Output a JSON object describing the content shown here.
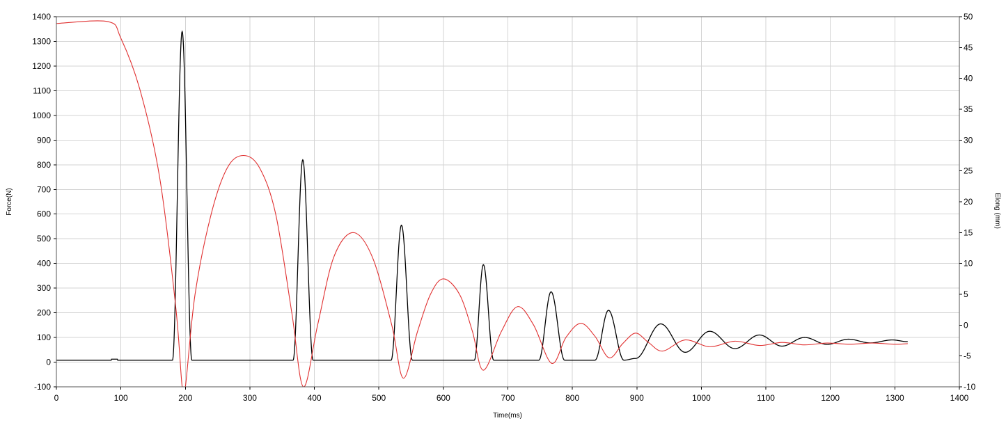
{
  "chart_data": {
    "type": "line",
    "xlabel": "Time(ms)",
    "ylabel": "Force(N)",
    "y2label": "Elong (mm)",
    "xlim": [
      0,
      1400
    ],
    "ylim": [
      -100,
      1400
    ],
    "y2lim": [
      -10,
      50
    ],
    "grid": true,
    "xticks": [
      "0",
      "100",
      "200",
      "300",
      "400",
      "500",
      "600",
      "700",
      "800",
      "900",
      "1000",
      "1100",
      "1200",
      "1300",
      "1400"
    ],
    "yticks": [
      "-100",
      "0",
      "100",
      "200",
      "300",
      "400",
      "500",
      "600",
      "700",
      "800",
      "900",
      "1000",
      "1100",
      "1200",
      "1300",
      "1400"
    ],
    "y2ticks": [
      "-10",
      "-5",
      "0",
      "5",
      "10",
      "15",
      "20",
      "25",
      "30",
      "35",
      "40",
      "45",
      "50"
    ],
    "series": [
      {
        "axis": "left",
        "color": "#000000",
        "baseline": 8,
        "start_x": 0,
        "end_x": 1320,
        "pulses": [
          {
            "start": 180,
            "peak_x": 195,
            "end": 210,
            "peak": 1340
          },
          {
            "start": 367,
            "peak_x": 382,
            "end": 398,
            "peak": 820
          },
          {
            "start": 519,
            "peak_x": 535,
            "end": 552,
            "peak": 555
          },
          {
            "start": 648,
            "peak_x": 662,
            "end": 678,
            "peak": 395
          },
          {
            "start": 748,
            "peak_x": 767,
            "end": 788,
            "peak": 285
          },
          {
            "start": 835,
            "peak_x": 856,
            "end": 880,
            "peak": 210
          }
        ],
        "tail_oscillation": [
          {
            "x": 898,
            "y": 15
          },
          {
            "x": 937,
            "y": 155
          },
          {
            "x": 975,
            "y": 40
          },
          {
            "x": 1013,
            "y": 125
          },
          {
            "x": 1052,
            "y": 55
          },
          {
            "x": 1090,
            "y": 110
          },
          {
            "x": 1125,
            "y": 65
          },
          {
            "x": 1160,
            "y": 100
          },
          {
            "x": 1195,
            "y": 72
          },
          {
            "x": 1228,
            "y": 93
          },
          {
            "x": 1262,
            "y": 78
          },
          {
            "x": 1296,
            "y": 90
          },
          {
            "x": 1320,
            "y": 83
          }
        ]
      },
      {
        "axis": "right",
        "color": "#e03030",
        "points": [
          {
            "x": 0,
            "y": 48.9
          },
          {
            "x": 80,
            "y": 49.2
          },
          {
            "x": 100,
            "y": 46.5
          },
          {
            "x": 130,
            "y": 38
          },
          {
            "x": 160,
            "y": 24
          },
          {
            "x": 185,
            "y": 3
          },
          {
            "x": 195,
            "y": -10
          },
          {
            "x": 200,
            "y": -10
          },
          {
            "x": 215,
            "y": 5
          },
          {
            "x": 240,
            "y": 18
          },
          {
            "x": 265,
            "y": 25.5
          },
          {
            "x": 290,
            "y": 27.5
          },
          {
            "x": 315,
            "y": 25.5
          },
          {
            "x": 340,
            "y": 18
          },
          {
            "x": 365,
            "y": 2
          },
          {
            "x": 383,
            "y": -10
          },
          {
            "x": 405,
            "y": 0
          },
          {
            "x": 430,
            "y": 11
          },
          {
            "x": 460,
            "y": 15
          },
          {
            "x": 490,
            "y": 11
          },
          {
            "x": 520,
            "y": 0
          },
          {
            "x": 538,
            "y": -8.6
          },
          {
            "x": 560,
            "y": -1
          },
          {
            "x": 580,
            "y": 5
          },
          {
            "x": 600,
            "y": 7.5
          },
          {
            "x": 625,
            "y": 5
          },
          {
            "x": 645,
            "y": -1
          },
          {
            "x": 662,
            "y": -7.3
          },
          {
            "x": 690,
            "y": -1
          },
          {
            "x": 715,
            "y": 3
          },
          {
            "x": 740,
            "y": 0
          },
          {
            "x": 768,
            "y": -6.2
          },
          {
            "x": 790,
            "y": -2
          },
          {
            "x": 813,
            "y": 0.3
          },
          {
            "x": 835,
            "y": -1.8
          },
          {
            "x": 857,
            "y": -5.3
          },
          {
            "x": 878,
            "y": -3
          },
          {
            "x": 898,
            "y": -1.3
          },
          {
            "x": 918,
            "y": -2.8
          },
          {
            "x": 940,
            "y": -4.2
          },
          {
            "x": 975,
            "y": -2.4
          },
          {
            "x": 1013,
            "y": -3.5
          },
          {
            "x": 1052,
            "y": -2.6
          },
          {
            "x": 1090,
            "y": -3.3
          },
          {
            "x": 1125,
            "y": -2.8
          },
          {
            "x": 1160,
            "y": -3.2
          },
          {
            "x": 1195,
            "y": -2.9
          },
          {
            "x": 1230,
            "y": -3.1
          },
          {
            "x": 1265,
            "y": -2.9
          },
          {
            "x": 1300,
            "y": -3.1
          },
          {
            "x": 1320,
            "y": -3
          }
        ]
      }
    ]
  }
}
